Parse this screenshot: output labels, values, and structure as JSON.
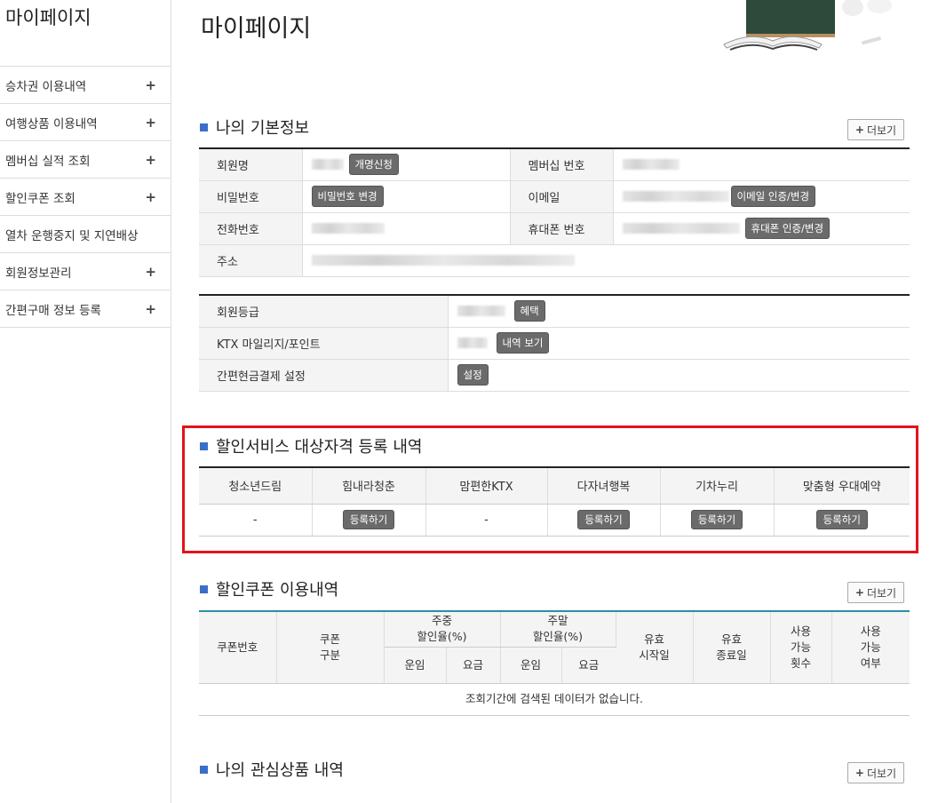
{
  "sidebar": {
    "title": "마이페이지",
    "items": [
      {
        "label": "승차권 이용내역",
        "icon": "+"
      },
      {
        "label": "여행상품 이용내역",
        "icon": "+"
      },
      {
        "label": "멤버십 실적 조회",
        "icon": "+"
      },
      {
        "label": "할인쿠폰 조회",
        "icon": "+"
      },
      {
        "label": "열차 운행중지 및 지연배상",
        "icon": ""
      },
      {
        "label": "회원정보관리",
        "icon": "+"
      },
      {
        "label": "간편구매 정보 등록",
        "icon": "+"
      }
    ]
  },
  "main": {
    "title": "마이페이지",
    "more_label": "더보기",
    "more_icon": "+",
    "basic_info": {
      "title": "나의 기본정보",
      "member_name_label": "회원명",
      "rename_btn": "개명신청",
      "membership_no_label": "멤버십 번호",
      "password_label": "비밀번호",
      "password_btn": "비밀번호 변경",
      "email_label": "이메일",
      "email_btn": "이메일 인증/변경",
      "phone_label": "전화번호",
      "mobile_label": "휴대폰 번호",
      "mobile_btn": "휴대폰 인증/변경",
      "address_label": "주소"
    },
    "grade_info": {
      "grade_label": "회원등급",
      "benefit_btn": "혜택",
      "mileage_label": "KTX 마일리지/포인트",
      "history_btn": "내역 보기",
      "cash_label": "간편현금결제 설정",
      "setting_btn": "설정"
    },
    "discount_service": {
      "title": "할인서비스 대상자격 등록 내역",
      "headers": [
        "청소년드림",
        "힘내라청춘",
        "맘편한KTX",
        "다자녀행복",
        "기차누리",
        "맞춤형 우대예약"
      ],
      "cells": [
        "-",
        "등록하기",
        "-",
        "등록하기",
        "등록하기",
        "등록하기"
      ]
    },
    "coupon": {
      "title": "할인쿠폰 이용내역",
      "h_coupon_no": "쿠폰번호",
      "h_coupon_type_1": "쿠폰",
      "h_coupon_type_2": "구분",
      "h_weekday_1": "주중",
      "h_weekday_2": "할인율(%)",
      "h_weekend_1": "주말",
      "h_weekend_2": "할인율(%)",
      "h_fare": "운임",
      "h_charge": "요금",
      "h_start_1": "유효",
      "h_start_2": "시작일",
      "h_end_1": "유효",
      "h_end_2": "종료일",
      "h_count_1": "사용",
      "h_count_2": "가능",
      "h_count_3": "횟수",
      "h_avail_1": "사용",
      "h_avail_2": "가능",
      "h_avail_3": "여부",
      "empty": "조회기간에 검색된 데이터가 없습니다."
    },
    "interest": {
      "title": "나의 관심상품 내역"
    }
  }
}
